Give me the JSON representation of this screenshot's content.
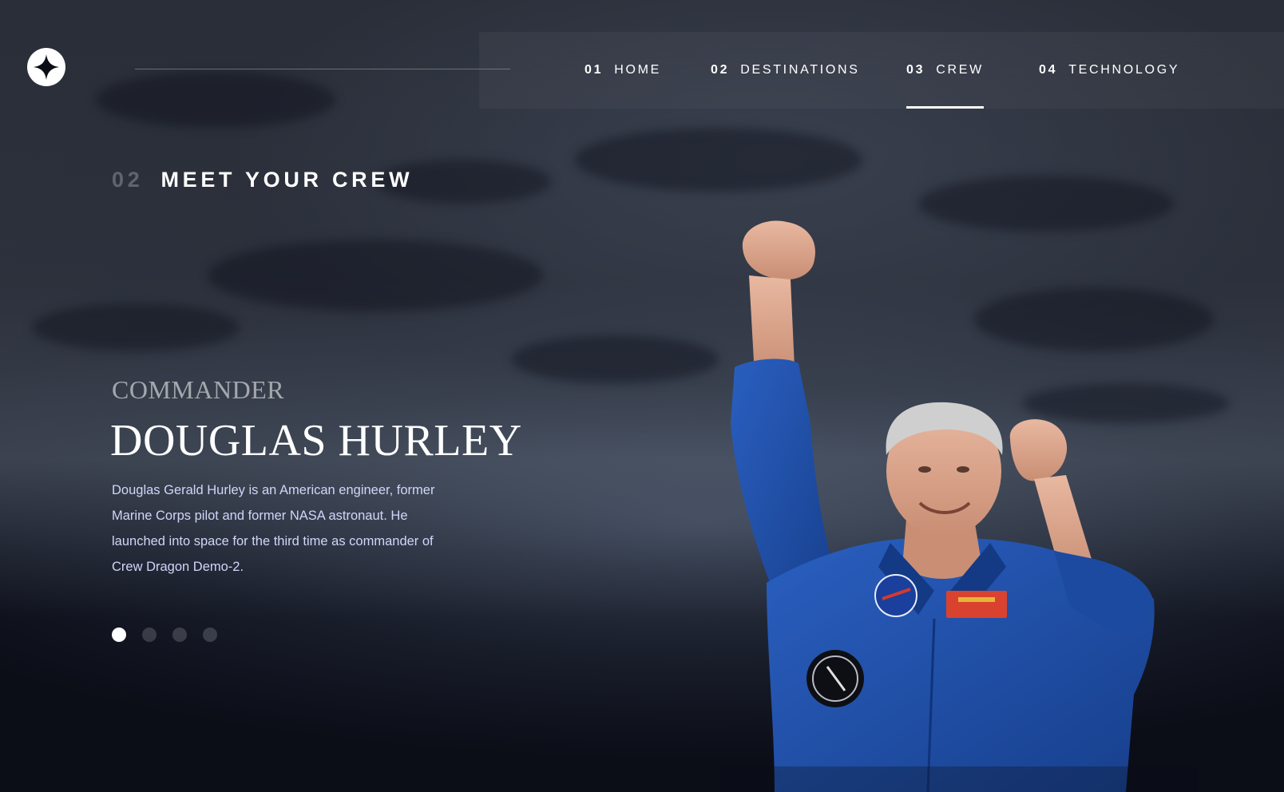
{
  "nav": {
    "items": [
      {
        "number": "01",
        "label": "HOME"
      },
      {
        "number": "02",
        "label": "DESTINATIONS"
      },
      {
        "number": "03",
        "label": "CREW",
        "active": true
      },
      {
        "number": "04",
        "label": "TECHNOLOGY"
      }
    ]
  },
  "page": {
    "heading_number": "02",
    "heading": "MEET YOUR CREW"
  },
  "crew": {
    "role": "COMMANDER",
    "name": "DOUGLAS HURLEY",
    "bio": "Douglas Gerald Hurley is an American engineer, former Marine Corps pilot and former NASA astronaut. He launched into space for the third time as commander of Crew Dragon Demo-2.",
    "slider": {
      "count": 4,
      "active_index": 0
    }
  },
  "colors": {
    "background": "#0b0d17",
    "text": "#ffffff",
    "body_text": "#d0d6f9",
    "suit": "#1f4fa8"
  },
  "icons": {
    "logo": "star-logo-icon"
  }
}
